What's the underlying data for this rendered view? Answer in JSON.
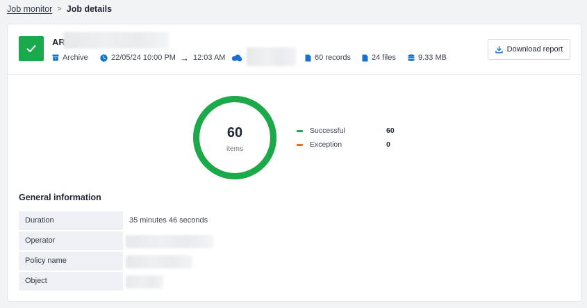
{
  "breadcrumb": {
    "parent": "Job monitor",
    "separator": ">",
    "current": "Job details"
  },
  "job": {
    "status_icon": "check-icon",
    "name_prefix": "AR",
    "type": "Archive",
    "start": "22/05/24 10:00 PM",
    "arrow": "→",
    "end": "12:03 AM",
    "records": "60 records",
    "files": "24 files",
    "size": "9.33 MB",
    "download_label": "Download report"
  },
  "summary": {
    "total": "60",
    "unit": "items",
    "success_fraction": 1.0,
    "legend": [
      {
        "label": "Successful",
        "value": "60",
        "color": "#1aaa4b"
      },
      {
        "label": "Exception",
        "value": "0",
        "color": "#f26a21"
      }
    ]
  },
  "general_info": {
    "title": "General information",
    "rows": [
      {
        "label": "Duration",
        "value": "35 minutes 46 seconds"
      },
      {
        "label": "Operator",
        "value": ""
      },
      {
        "label": "Policy name",
        "value": ""
      },
      {
        "label": "Object",
        "value": ""
      }
    ]
  },
  "colors": {
    "success": "#1aaa4b",
    "exception": "#f26a21",
    "accent": "#1a73c8",
    "cloud": "#1c6fd1"
  }
}
